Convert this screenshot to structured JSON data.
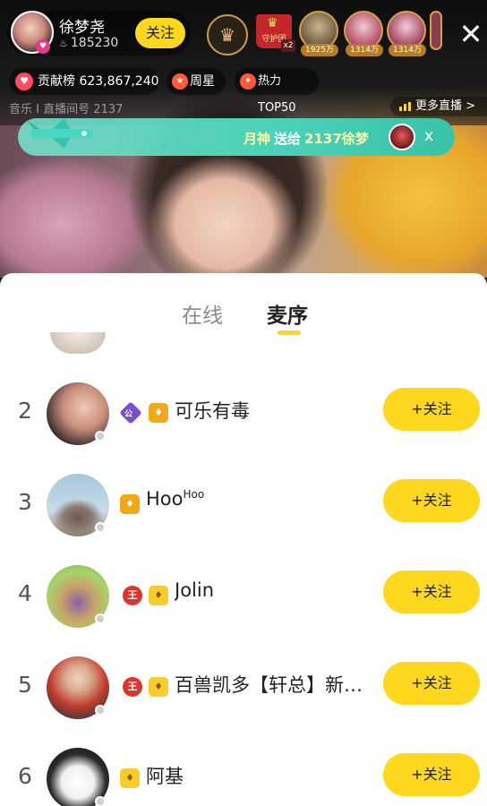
{
  "host": {
    "name": "徐梦尧",
    "fans": "185230",
    "follow_label": "关注"
  },
  "guard_badge": {
    "label": "守护团",
    "multiplier": "x2"
  },
  "top_viewers": [
    {
      "count": "1925万"
    },
    {
      "count": "1314万"
    },
    {
      "count": "1314万"
    }
  ],
  "stats": {
    "contribution_label": "贡献榜",
    "contribution_value": "623,867,240",
    "week_star_label": "周星",
    "hot_label": "热力 TOP50"
  },
  "room": {
    "category": "音乐",
    "separator": "I",
    "room_id_label": "直播间号",
    "room_id": "2137"
  },
  "more_live_label": "更多直播 >",
  "gift_banner": {
    "sender": "月神",
    "action": "送给",
    "receiver": "2137徐梦",
    "close": "x"
  },
  "tabs": [
    {
      "label": "在线",
      "active": false
    },
    {
      "label": "麦序",
      "active": true
    }
  ],
  "queue": [
    {
      "rank": "2",
      "name": "可乐有毒",
      "badges": [
        "公",
        "shirt"
      ],
      "follow_label": "+关注"
    },
    {
      "rank": "3",
      "name": "Hoo",
      "name_sup": "Hoo",
      "badges": [
        "shirt"
      ],
      "follow_label": "+关注"
    },
    {
      "rank": "4",
      "name": "Jolin",
      "badges": [
        "王",
        "shirt"
      ],
      "follow_label": "+关注"
    },
    {
      "rank": "5",
      "name": "百兽凯多【轩总】新…",
      "badges": [
        "王",
        "shirt"
      ],
      "follow_label": "+关注"
    },
    {
      "rank": "6",
      "name": "阿基",
      "badges": [
        "shirt"
      ],
      "follow_label": "+关注"
    }
  ],
  "colors": {
    "accent": "#ffd71e",
    "banner": "#4dd3b9",
    "official_badge": "#7b4fc9",
    "king_badge": "#d9362f"
  }
}
